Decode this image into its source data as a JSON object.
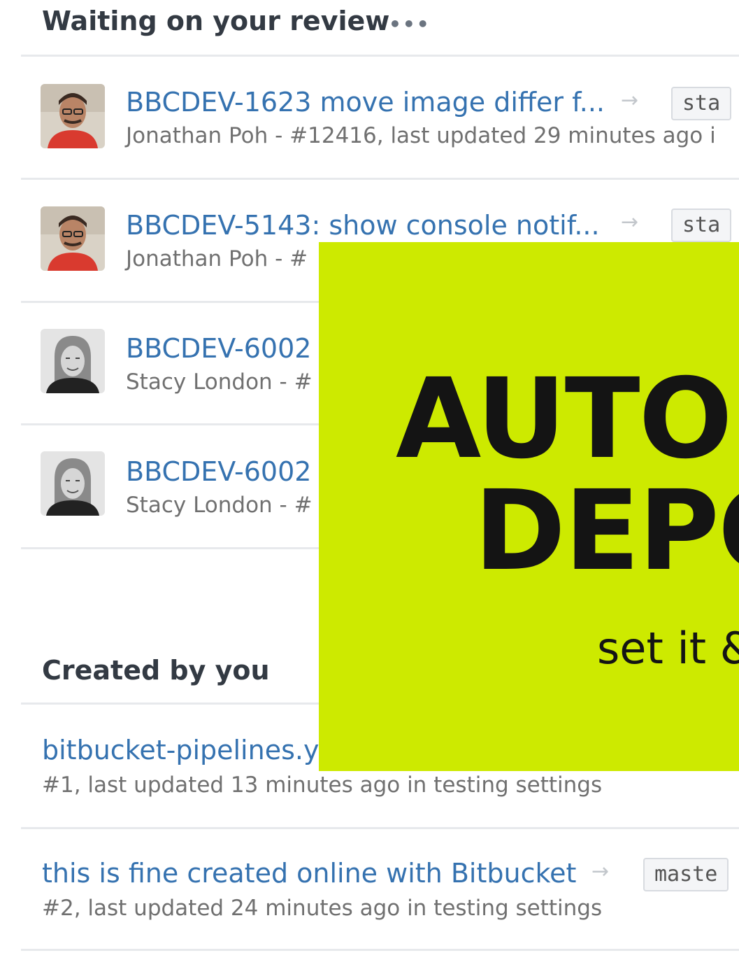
{
  "waiting_section": {
    "title": "Waiting on your review",
    "more_label": "•••",
    "items": [
      {
        "title": "BBCDEV-1623 move image differ f...",
        "meta": "Jonathan Poh - #12416, last updated 29 minutes ago i",
        "branch": "sta",
        "author_avatar": "color-photo"
      },
      {
        "title": "BBCDEV-5143: show console notif...",
        "meta": "Jonathan Poh - #",
        "branch": "sta",
        "author_avatar": "color-photo"
      },
      {
        "title": "BBCDEV-6002",
        "meta": "Stacy London - #",
        "author_avatar": "grayscale-photo"
      },
      {
        "title": "BBCDEV-6002",
        "meta": "Stacy London - #",
        "author_avatar": "grayscale-photo"
      }
    ]
  },
  "created_section": {
    "title": "Created by you",
    "items": [
      {
        "title": "bitbucket-pipelines.y",
        "meta": "#1, last updated 13 minutes ago in testing settings"
      },
      {
        "title": "this is fine created online with Bitbucket",
        "meta": "#2, last updated 24 minutes ago in testing settings",
        "branch": "maste"
      }
    ]
  },
  "overlay": {
    "line1": "AUTOM",
    "line2": "DEPO",
    "tagline": "set it &",
    "background_color": "#cdea00"
  },
  "colors": {
    "link": "#3572b0",
    "meta_text": "#707070",
    "heading": "#333a43"
  }
}
